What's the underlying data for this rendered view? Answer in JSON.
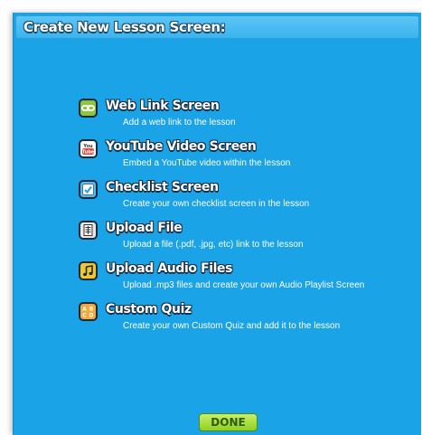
{
  "dialog": {
    "title": "Create New Lesson Screen:"
  },
  "options": [
    {
      "icon": "web-link-icon",
      "icon_color": "#8cc63f",
      "title": "Web Link Screen",
      "description": "Add a web link to the lesson"
    },
    {
      "icon": "youtube-icon",
      "icon_color": "#e8453c",
      "title": "YouTube Video Screen",
      "description": "Embed a YouTube video within the lesson"
    },
    {
      "icon": "checklist-icon",
      "icon_color": "#5fb7e8",
      "title": "Checklist Screen",
      "description": "Create your own checklist screen in the lesson"
    },
    {
      "icon": "upload-file-icon",
      "icon_color": "#e8e8e8",
      "title": "Upload File",
      "description": "Upload a file (.pdf, .jpg, etc) link to the lesson"
    },
    {
      "icon": "music-note-icon",
      "icon_color": "#f2c62e",
      "title": "Upload Audio Files",
      "description": "Upload .mp3 files and create your own Audio Playlist Screen"
    },
    {
      "icon": "quiz-abcd-icon",
      "icon_color": "#f4a93c",
      "title": "Custom Quiz",
      "description": "Create your own Custom Quiz and add it to the lesson"
    }
  ],
  "done_button": {
    "label": "DONE"
  }
}
